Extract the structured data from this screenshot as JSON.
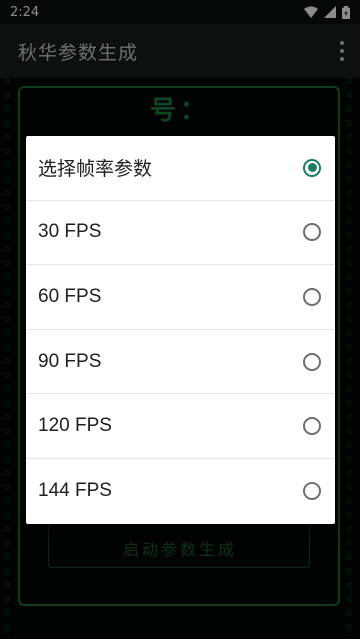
{
  "status_bar": {
    "time": "2:24"
  },
  "app_bar": {
    "title": "秋华参数生成"
  },
  "background": {
    "heading_fragment": "号：",
    "start_button": "启动参数生成"
  },
  "dialog": {
    "accent_color": "#1a7b64",
    "options": [
      {
        "label": "选择帧率参数",
        "selected": true
      },
      {
        "label": "30 FPS",
        "selected": false
      },
      {
        "label": "60 FPS",
        "selected": false
      },
      {
        "label": "90 FPS",
        "selected": false
      },
      {
        "label": "120 FPS",
        "selected": false
      },
      {
        "label": "144 FPS",
        "selected": false
      }
    ]
  }
}
